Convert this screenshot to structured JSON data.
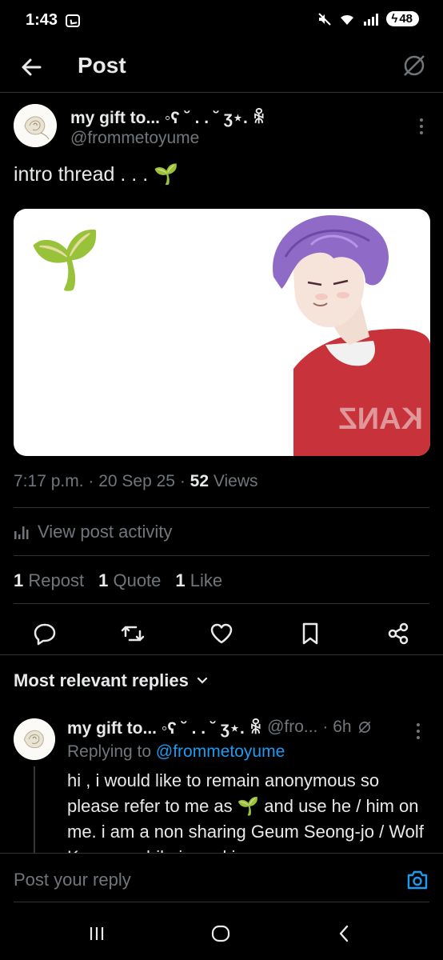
{
  "status_bar": {
    "time": "1:43",
    "battery": "48"
  },
  "header": {
    "title": "Post"
  },
  "post": {
    "author_name": "my gift to... ◦ʕ ˘ . . ˘ ʒ⋆. ꆜ",
    "author_handle": "@frommetoyume",
    "text": "intro thread . . . 🌱",
    "image_emoji": "🌱",
    "meta": {
      "time": "7:17 p.m.",
      "date": "20 Sep 25",
      "views_count": "52",
      "views_label": "Views"
    },
    "activity_label": "View post activity",
    "stats": [
      {
        "count": "1",
        "label": "Repost"
      },
      {
        "count": "1",
        "label": "Quote"
      },
      {
        "count": "1",
        "label": "Like"
      }
    ],
    "actions": [
      "reply-icon",
      "repost-icon",
      "like-icon",
      "bookmark-icon",
      "share-icon"
    ]
  },
  "replies_section": {
    "sort_label": "Most relevant replies"
  },
  "reply": {
    "author_name": "my gift to... ◦ʕ ˘ . . ˘ ʒ⋆. ꆜ",
    "handle": "@fro...",
    "time": "· 6h",
    "replying_prefix": "Replying to",
    "replying_to": "@frommetoyume",
    "body": "hi , i would like to remain anonymous so please refer to me as 🌱 and use he / him on me. i am a non sharing Geum Seong-jo / Wolf Keum goshikai , and i am"
  },
  "reply_bar": {
    "placeholder": "Post your reply"
  },
  "colors": {
    "background": "#000000",
    "text": "#e7e9ea",
    "muted": "#71767b",
    "accent": "#1d9bf0",
    "divider": "#2f3336"
  }
}
